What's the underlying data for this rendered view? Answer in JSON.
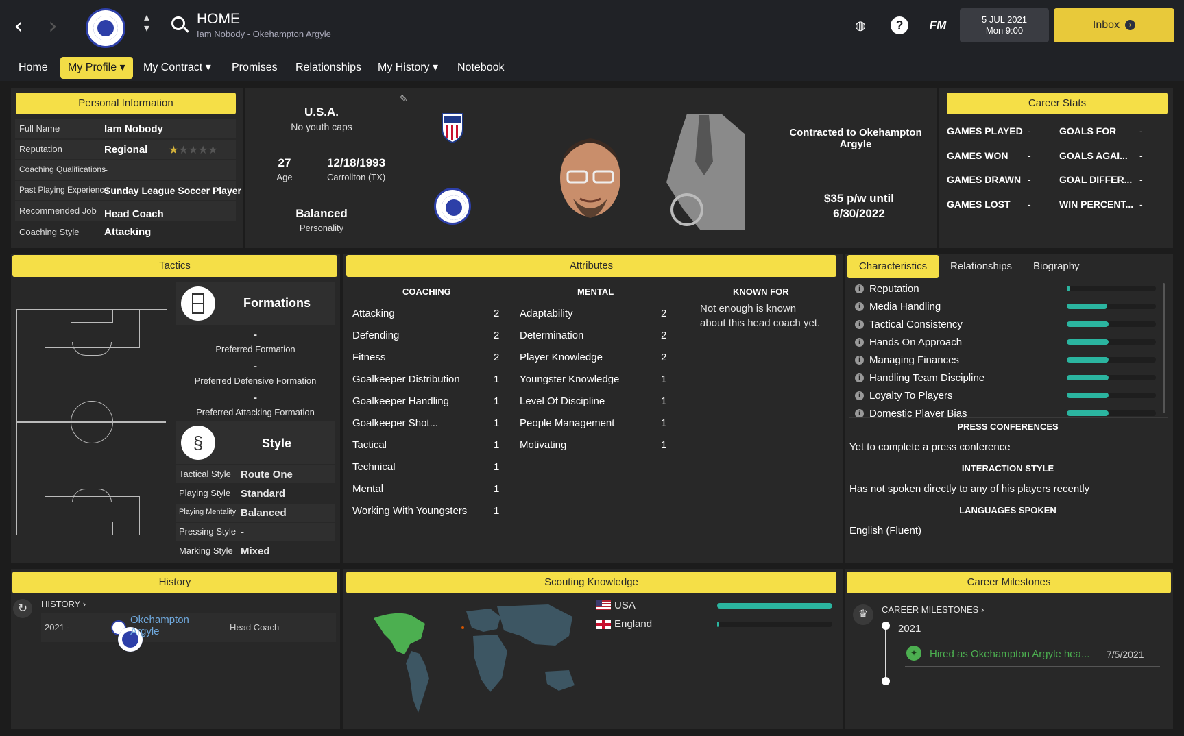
{
  "header": {
    "title": "HOME",
    "subtitle": "Iam Nobody - Okehampton Argyle",
    "date": "5 JUL 2021",
    "time": "Mon 9:00",
    "inbox_label": "Inbox",
    "fm_label": "FM",
    "help_label": "?"
  },
  "nav": [
    "Home",
    "My Profile",
    "My Contract",
    "Promises",
    "Relationships",
    "My History",
    "Notebook"
  ],
  "personal": {
    "title": "Personal Information",
    "rows": [
      {
        "label": "Full Name",
        "value": "Iam Nobody"
      },
      {
        "label": "Reputation",
        "value": "Regional"
      },
      {
        "label": "Coaching Qualifications",
        "value": "-"
      },
      {
        "label": "Past Playing Experience",
        "value": "Sunday League Soccer Player"
      },
      {
        "label": "Recommended Job",
        "value": "Head Coach"
      },
      {
        "label": "Coaching Style",
        "value": "Attacking"
      }
    ],
    "reputation_stars": 0.5
  },
  "profile": {
    "nation": "U.S.A.",
    "caps": "No youth caps",
    "age": "27",
    "age_label": "Age",
    "dob": "12/18/1993",
    "birthplace": "Carrollton (TX)",
    "personality": "Balanced",
    "personality_label": "Personality",
    "contract": "Contracted to Okehampton Argyle",
    "wage": "$35 p/w until",
    "until": "6/30/2022"
  },
  "career": {
    "title": "Career Stats",
    "stats": [
      {
        "label": "GAMES PLAYED",
        "value": "-"
      },
      {
        "label": "GOALS FOR",
        "value": "-"
      },
      {
        "label": "GAMES WON",
        "value": "-"
      },
      {
        "label": "GOALS AGAI...",
        "value": "-"
      },
      {
        "label": "GAMES DRAWN",
        "value": "-"
      },
      {
        "label": "GOAL DIFFER...",
        "value": "-"
      },
      {
        "label": "GAMES LOST",
        "value": "-"
      },
      {
        "label": "WIN PERCENT...",
        "value": "-"
      }
    ]
  },
  "tactics": {
    "title": "Tactics",
    "formations_label": "Formations",
    "pref_formation": "-",
    "pref_formation_label": "Preferred Formation",
    "def_formation": "-",
    "def_formation_label": "Preferred Defensive Formation",
    "att_formation": "-",
    "att_formation_label": "Preferred Attacking Formation",
    "style_label": "Style",
    "styles": [
      {
        "label": "Tactical Style",
        "value": "Route One"
      },
      {
        "label": "Playing Style",
        "value": "Standard"
      },
      {
        "label": "Playing Mentality",
        "value": "Balanced"
      },
      {
        "label": "Pressing Style",
        "value": "-"
      },
      {
        "label": "Marking Style",
        "value": "Mixed"
      }
    ]
  },
  "attributes": {
    "title": "Attributes",
    "coaching_label": "COACHING",
    "mental_label": "MENTAL",
    "known_label": "KNOWN FOR",
    "known_text_1": "Not enough is known",
    "known_text_2": "about this head coach yet.",
    "coaching": [
      {
        "name": "Attacking",
        "value": "2"
      },
      {
        "name": "Defending",
        "value": "2"
      },
      {
        "name": "Fitness",
        "value": "2"
      },
      {
        "name": "Goalkeeper Distribution",
        "value": "1"
      },
      {
        "name": "Goalkeeper Handling",
        "value": "1"
      },
      {
        "name": "Goalkeeper Shot...",
        "value": "1"
      },
      {
        "name": "Tactical",
        "value": "1"
      },
      {
        "name": "Technical",
        "value": "1"
      },
      {
        "name": "Mental",
        "value": "1"
      },
      {
        "name": "Working With Youngsters",
        "value": "1"
      }
    ],
    "mental": [
      {
        "name": "Adaptability",
        "value": "2"
      },
      {
        "name": "Determination",
        "value": "2"
      },
      {
        "name": "Player Knowledge",
        "value": "2"
      },
      {
        "name": "Youngster Knowledge",
        "value": "1"
      },
      {
        "name": "Level Of Discipline",
        "value": "1"
      },
      {
        "name": "People Management",
        "value": "1"
      },
      {
        "name": "Motivating",
        "value": "1"
      }
    ]
  },
  "characteristics": {
    "tabs": [
      "Characteristics",
      "Relationships",
      "Biography"
    ],
    "items": [
      {
        "name": "Reputation",
        "level": 0.03
      },
      {
        "name": "Media Handling",
        "level": 0.45
      },
      {
        "name": "Tactical Consistency",
        "level": 0.47
      },
      {
        "name": "Hands On Approach",
        "level": 0.47
      },
      {
        "name": "Managing Finances",
        "level": 0.47
      },
      {
        "name": "Handling Team Discipline",
        "level": 0.47
      },
      {
        "name": "Loyalty To Players",
        "level": 0.47
      },
      {
        "name": "Domestic Player Bias",
        "level": 0.47
      }
    ],
    "press_label": "PRESS CONFERENCES",
    "press_text": "Yet to complete a press conference",
    "interaction_label": "INTERACTION STYLE",
    "interaction_text": "Has not spoken directly to any of his players recently",
    "languages_label": "LANGUAGES SPOKEN",
    "languages_text": "English (Fluent)"
  },
  "history": {
    "title": "History",
    "header": "HISTORY",
    "year": "2021 -",
    "club_line1": "Okehampton",
    "club_line2": "Argyle",
    "role": "Head Coach"
  },
  "scouting": {
    "title": "Scouting Knowledge",
    "items": [
      {
        "name": "USA",
        "level": 1.0
      },
      {
        "name": "England",
        "level": 0.02
      }
    ]
  },
  "milestones": {
    "title": "Career Milestones",
    "header": "CAREER MILESTONES",
    "year": "2021",
    "text": "Hired as Okehampton Argyle hea...",
    "date": "7/5/2021"
  },
  "colors": {
    "accent": "#f5df47",
    "teal": "#2bb5a0",
    "panel": "#282828"
  }
}
